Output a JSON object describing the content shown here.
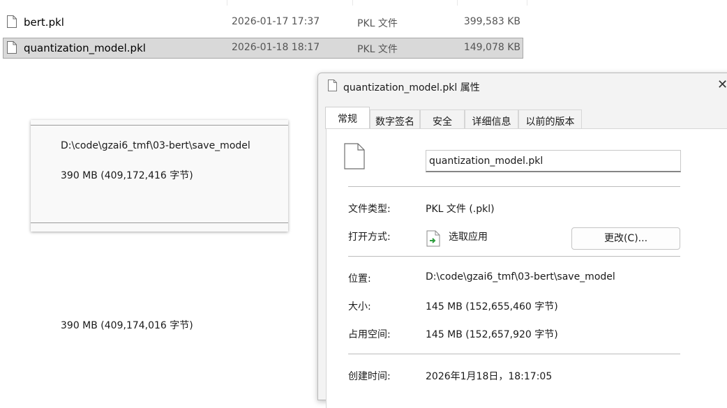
{
  "file_list": {
    "rows": [
      {
        "name": "bert.pkl",
        "date": "2026-01-17 17:37",
        "type": "PKL 文件",
        "size": "399,583 KB",
        "selected": false
      },
      {
        "name": "quantization_model.pkl",
        "date": "2026-01-18 18:17",
        "type": "PKL 文件",
        "size": "149,078 KB",
        "selected": true
      }
    ]
  },
  "left_panel": {
    "location": "D:\\code\\gzai6_tmf\\03-bert\\save_model",
    "size": "390 MB (409,172,416 字节)",
    "size_on_disk": "390 MB (409,174,016 字节)"
  },
  "dialog": {
    "title": "quantization_model.pkl 属性",
    "close": "✕",
    "tabs": [
      "常规",
      "数字签名",
      "安全",
      "详细信息",
      "以前的版本"
    ],
    "active_tab": "常规",
    "filename": "quantization_model.pkl",
    "file_type_label": "文件类型:",
    "file_type_value": "PKL 文件 (.pkl)",
    "opens_with_label": "打开方式:",
    "opens_with_value": "选取应用",
    "change_button": "更改(C)...",
    "location_label": "位置:",
    "location_value": "D:\\code\\gzai6_tmf\\03-bert\\save_model",
    "size_label": "大小:",
    "size_value": "145 MB (152,655,460 字节)",
    "size_on_disk_label": "占用空间:",
    "size_on_disk_value": "145 MB (152,657,920 字节)",
    "created_label": "创建时间:",
    "created_value": "2026年1月18日，18:17:05"
  },
  "icons": {
    "file": "blank-file-icon",
    "app": "choose-app-icon",
    "close": "close-icon"
  },
  "colors": {
    "selected_row": "#d9d9d9",
    "dialog_bg": "#f3f3f3",
    "tab_body": "#ffffff"
  }
}
